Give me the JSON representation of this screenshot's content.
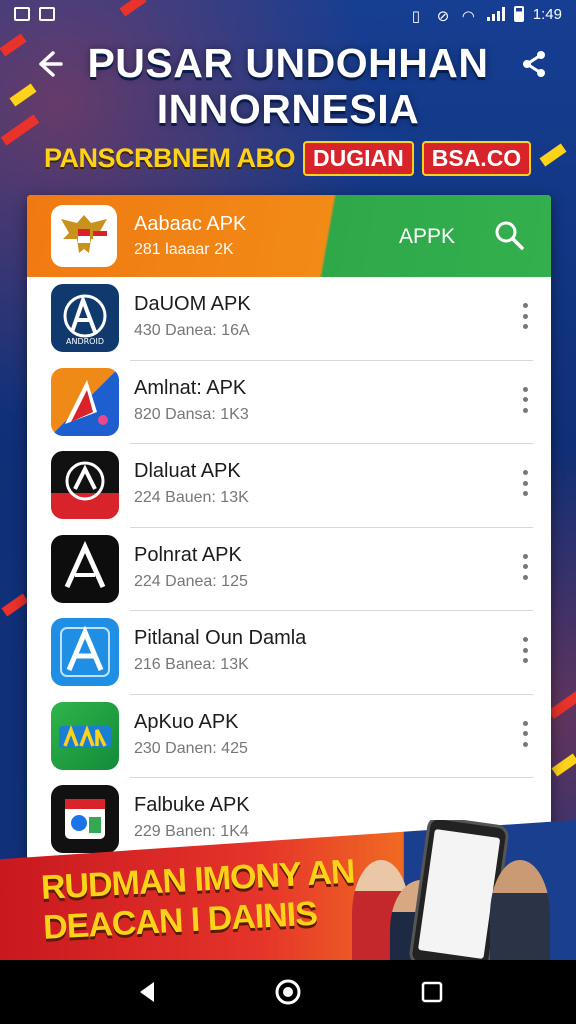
{
  "status_bar": {
    "time": "1:49"
  },
  "header": {
    "title_line1": "PUSAR UNDOHHAN",
    "title_line2": "INNORNESIA",
    "subtitle": "PANSCRBNEM ABO",
    "tag1": "DUGIAN",
    "tag2": "BSA.CO"
  },
  "featured": {
    "name": "Aabaac APK",
    "meta": "281 laaaar 2K",
    "action_label": "APPK"
  },
  "apps": [
    {
      "name": "DaUOM APK",
      "meta": "430 Danea: 16A",
      "icon": "apk-logo-blue-icon"
    },
    {
      "name": "Amlnat: APK",
      "meta": "820 Dansa: 1K3",
      "icon": "arrow-logo-icon"
    },
    {
      "name": "Dlaluat APK",
      "meta": "224 Bauen: 13K",
      "icon": "circle-logo-icon"
    },
    {
      "name": "Polnrat APK",
      "meta": "224 Danea: 125",
      "icon": "triangle-logo-icon"
    },
    {
      "name": "Pitlanal Oun Damla",
      "meta": "216 Banea: 13K",
      "icon": "blue-a-logo-icon"
    },
    {
      "name": "ApKuo APK",
      "meta": "230 Danen: 425",
      "icon": "green-apk-logo-icon"
    },
    {
      "name": "Falbuke APK",
      "meta": "229 Banen: 1K4",
      "icon": "browser-logo-icon"
    }
  ],
  "promo": {
    "line1": "RUDMAN IMONY AN",
    "line2": "DEACAN I DAINIS"
  },
  "colors": {
    "background": "#0f2f77",
    "orange": "#f28a16",
    "green": "#33b04d",
    "yellow": "#ffd21a",
    "red": "#d8232a"
  }
}
